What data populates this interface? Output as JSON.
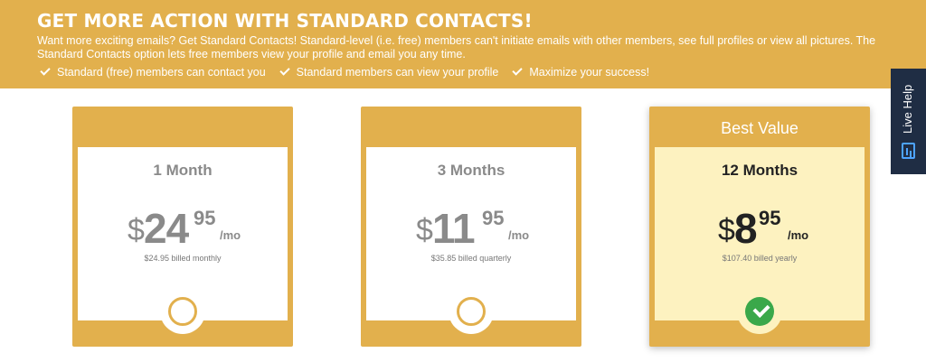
{
  "banner": {
    "title": "GET MORE ACTION WITH STANDARD CONTACTS!",
    "description": "Want more exciting emails? Get Standard Contacts! Standard-level (i.e. free) members can't initiate emails with other members, see full profiles or view all pictures. The Standard Contacts option lets free members view your profile and email you any time.",
    "benefits": [
      "Standard (free) members can contact you",
      "Standard members can view your profile",
      "Maximize your success!"
    ]
  },
  "plans": [
    {
      "header": "",
      "term": "1 Month",
      "currency": "$",
      "whole": "24",
      "cents": "95",
      "per": "/mo",
      "billed": "$24.95 billed monthly",
      "selected": false
    },
    {
      "header": "",
      "term": "3 Months",
      "currency": "$",
      "whole": "11",
      "cents": "95",
      "per": "/mo",
      "billed": "$35.85 billed quarterly",
      "selected": false
    },
    {
      "header": "Best Value",
      "term": "12 Months",
      "currency": "$",
      "whole": "8",
      "cents": "95",
      "per": "/mo",
      "billed": "$107.40 billed yearly",
      "selected": true
    }
  ],
  "live_help": {
    "label": "Live Help",
    "icon": "chat-icon"
  },
  "colors": {
    "accent": "#e2b04d",
    "best_panel": "#fdf2c0",
    "selected": "#3aa84a",
    "live_help_bg": "#1f2d44"
  }
}
